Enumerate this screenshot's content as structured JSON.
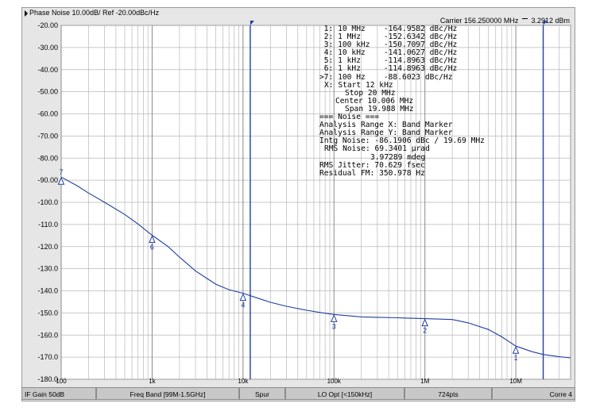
{
  "header": {
    "title": "Phase Noise 10.00dB/ Ref -20.00dBc/Hz",
    "carrier": "Carrier 156.250000 MHz",
    "carrier_power": "3.2912 dBm"
  },
  "markers": [
    {
      "id": "1:",
      "freq": "10 MHz",
      "value": "-164.9582 dBc/Hz"
    },
    {
      "id": "2:",
      "freq": "1 MHz",
      "value": "-152.6342 dBc/Hz"
    },
    {
      "id": "3:",
      "freq": "100 kHz",
      "value": "-150.7097 dBc/Hz"
    },
    {
      "id": "4:",
      "freq": "10 kHz",
      "value": "-141.0627 dBc/Hz"
    },
    {
      "id": "5:",
      "freq": "1 kHz",
      "value": "-114.8963 dBc/Hz"
    },
    {
      "id": "6:",
      "freq": "1 kHz",
      "value": "-114.8963 dBc/Hz"
    },
    {
      "id": ">7:",
      "freq": "100 Hz",
      "value": "-88.6023 dBc/Hz"
    }
  ],
  "analysis": {
    "start": "X: Start 12 kHz",
    "stop": "Stop 20 MHz",
    "center": "Center 10.006 MHz",
    "span": "Span 19.988 MHz",
    "noise_header": "=== Noise ===",
    "range_x": "Analysis Range X: Band Marker",
    "range_y": "Analysis Range Y: Band Marker",
    "intg_noise": "Intg Noise: -86.1906 dBc / 19.69 MHz",
    "rms_noise_rad": "RMS Noise: 69.3401 µrad",
    "rms_noise_deg": "3.97289 mdeg",
    "rms_jitter": "RMS Jitter: 70.629 fsec",
    "residual_fm": "Residual FM: 350.978 Hz"
  },
  "status_bar": {
    "if_gain": "IF Gain 50dB",
    "freq_band": "Freq Band [99M-1.5GHz]",
    "spur": "Spur",
    "lo_opt": "LO Opt [<150kHz]",
    "points": "724pts",
    "corre": "Corre 4"
  },
  "chart_data": {
    "type": "line",
    "xscale": "log",
    "xlim": [
      100,
      40000000
    ],
    "ylim": [
      -180,
      -20
    ],
    "ylabel_ticks": [
      "-20.00",
      "-30.00",
      "-40.00",
      "-50.00",
      "-60.00",
      "-70.00",
      "-80.00",
      "-90.00",
      "-100.0",
      "-110.0",
      "-120.0",
      "-130.0",
      "-140.0",
      "-150.0",
      "-160.0",
      "-170.0",
      "-180.0"
    ],
    "xtick_labels": [
      "100",
      "1k",
      "10k",
      "100k",
      "1M",
      "10M"
    ],
    "grid": true,
    "series": [
      {
        "color": "#1f3fa0",
        "x": [
          100,
          150,
          200,
          300,
          500,
          700,
          1000,
          1500,
          2000,
          3000,
          5000,
          7000,
          10000,
          15000,
          20000,
          30000,
          50000,
          70000,
          100000,
          200000,
          300000,
          500000,
          700000,
          1000000,
          2000000,
          3000000,
          5000000,
          7000000,
          10000000,
          15000000,
          20000000,
          30000000,
          40000000
        ],
        "y": [
          -88.6,
          -92.5,
          -95.8,
          -100.0,
          -105.5,
          -109.8,
          -114.9,
          -120.0,
          -124.8,
          -131.0,
          -137.0,
          -139.5,
          -141.1,
          -143.5,
          -145.2,
          -147.0,
          -148.8,
          -149.8,
          -150.7,
          -151.8,
          -152.0,
          -152.2,
          -152.4,
          -152.6,
          -153.0,
          -154.5,
          -157.5,
          -160.8,
          -165.0,
          -167.5,
          -168.8,
          -169.8,
          -170.3
        ]
      }
    ],
    "marker_points": [
      {
        "label": "7",
        "x": 100,
        "y": -88.6
      },
      {
        "label": "6",
        "x": 1000,
        "y": -114.9
      },
      {
        "label": "4",
        "x": 10000,
        "y": -141.1
      },
      {
        "label": "3",
        "x": 100000,
        "y": -150.7
      },
      {
        "label": "2",
        "x": 1000000,
        "y": -152.6
      },
      {
        "label": "1",
        "x": 10000000,
        "y": -165.0
      }
    ],
    "band_markers": [
      {
        "x": 12000,
        "color": "#1f3fa0"
      },
      {
        "x": 20000000,
        "color": "#1f3fa0"
      }
    ]
  }
}
